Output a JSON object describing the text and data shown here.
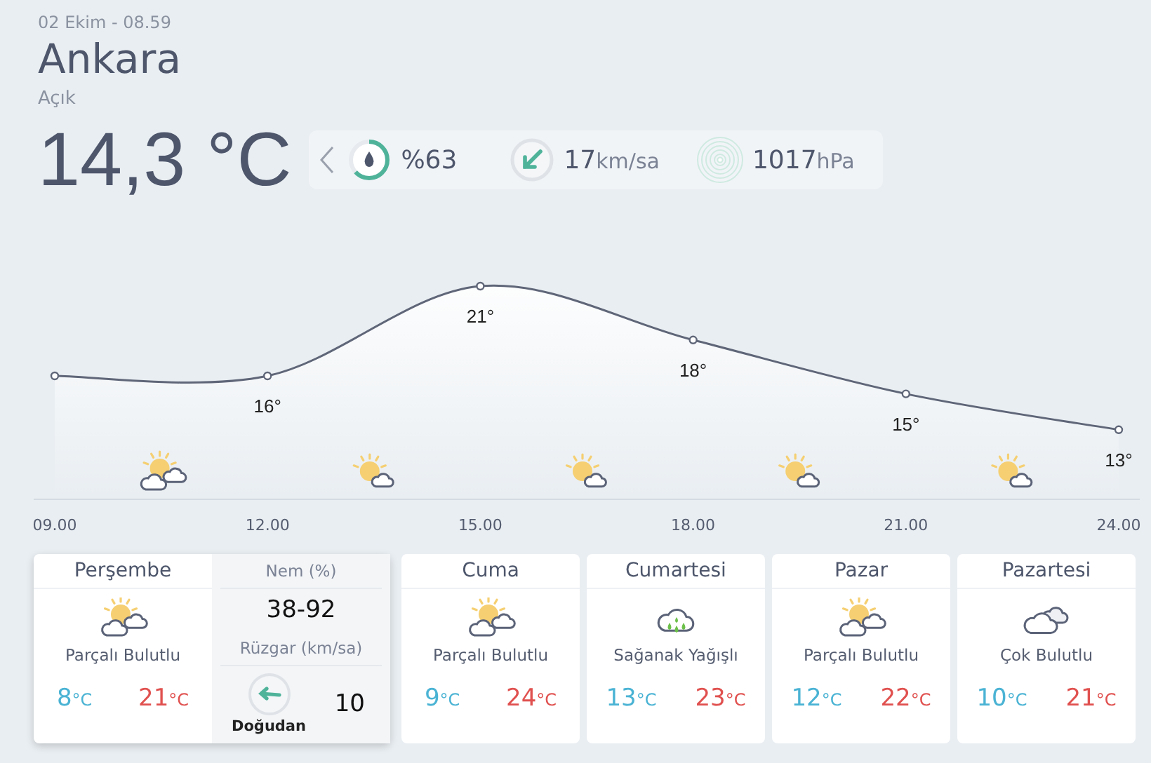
{
  "header": {
    "datetime": "02 Ekim - 08.59",
    "city": "Ankara",
    "condition": "Açık",
    "temperature": "14,3 °C"
  },
  "current": {
    "humidity": {
      "value": "%63",
      "level": 0.63
    },
    "wind": {
      "value": "17",
      "unit": "km/sa"
    },
    "pressure": {
      "value": "1017",
      "unit": "hPa"
    }
  },
  "hourly": {
    "chart_data": {
      "type": "area",
      "categories": [
        "09.00",
        "12.00",
        "15.00",
        "18.00",
        "21.00",
        "24.00"
      ],
      "series": [
        {
          "color": "#5f6678",
          "marker": true,
          "values": [
            16,
            16,
            21,
            18,
            15,
            13
          ],
          "value_labels": [
            null,
            "16°",
            "21°",
            "18°",
            "15°",
            "13°"
          ]
        }
      ]
    },
    "icons": [
      {
        "kind": "partly_cloudy"
      },
      {
        "kind": "mostly_sunny"
      },
      {
        "kind": "mostly_sunny"
      },
      {
        "kind": "mostly_sunny"
      },
      {
        "kind": "mostly_sunny"
      }
    ]
  },
  "days": [
    {
      "name": "Perşembe",
      "kind": "partly_cloudy",
      "description": "Parçalı Bulutlu",
      "low": "8",
      "low_unit": "°C",
      "high": "21",
      "high_unit": "°C",
      "expanded": true,
      "details": {
        "humidity_label": "Nem (%)",
        "humidity": "38-92",
        "wind_label": "Rüzgar (km/sa)",
        "wind_direction": "Doğudan",
        "wind_speed": "10"
      }
    },
    {
      "name": "Cuma",
      "kind": "partly_cloudy",
      "description": "Parçalı Bulutlu",
      "low": "9",
      "low_unit": "°C",
      "high": "24",
      "high_unit": "°C",
      "expanded": false
    },
    {
      "name": "Cumartesi",
      "kind": "showers",
      "description": "Sağanak Yağışlı",
      "low": "13",
      "low_unit": "°C",
      "high": "23",
      "high_unit": "°C",
      "expanded": false
    },
    {
      "name": "Pazar",
      "kind": "partly_cloudy",
      "description": "Parçalı Bulutlu",
      "low": "12",
      "low_unit": "°C",
      "high": "22",
      "high_unit": "°C",
      "expanded": false
    },
    {
      "name": "Pazartesi",
      "kind": "cloudy",
      "description": "Çok Bulutlu",
      "low": "10",
      "low_unit": "°C",
      "high": "21",
      "high_unit": "°C",
      "expanded": false
    }
  ]
}
